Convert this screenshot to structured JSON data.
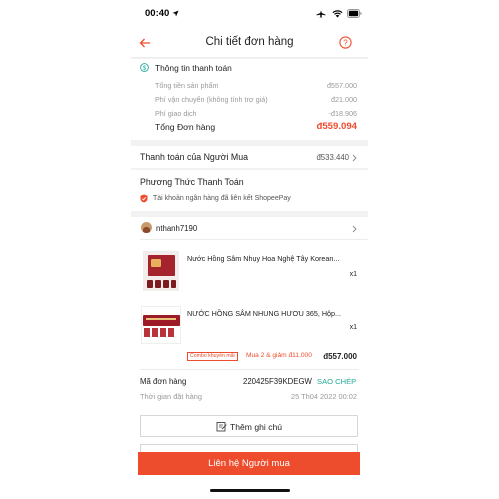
{
  "status_bar": {
    "time": "00:40"
  },
  "header": {
    "title": "Chi tiết đơn hàng"
  },
  "payment_info": {
    "title": "Thông tin thanh toán",
    "rows": [
      {
        "label": "Tổng tiền sản phẩm",
        "value": "đ557.000"
      },
      {
        "label": "Phí vận chuyển (không tính trợ giá)",
        "value": "đ21.000"
      },
      {
        "label": "Phí giao dịch",
        "value": "-đ18.906"
      }
    ],
    "total_label": "Tổng Đơn hàng",
    "total_value": "đ559.094"
  },
  "buyer_payment": {
    "label": "Thanh toán của Người Mua",
    "value": "đ533.440"
  },
  "payment_method": {
    "title": "Phương Thức Thanh Toán",
    "desc": "Tài khoản ngân hàng đã liên kết ShopeePay"
  },
  "shop": {
    "name": "nthanh7190"
  },
  "products": [
    {
      "name": "Nước Hồng Sâm Nhụy Hoa Nghệ Tây Korean...",
      "qty": "x1"
    },
    {
      "name": "NƯỚC HỒNG SÂM NHUNG HƯƠU 365, Hộp...",
      "qty": "x1"
    }
  ],
  "combo": {
    "badge": "Combo khuyến mãi",
    "text": "Mua 2 & giảm đ11.000",
    "total": "đ557.000"
  },
  "order": {
    "id_label": "Mã đơn hàng",
    "id_value": "220425F39KDEGW",
    "copy_label": "SAO CHÉP",
    "time_label": "Thời gian đặt hàng",
    "time_value": "25 Th04 2022 00:02"
  },
  "actions": {
    "note_label": "Thêm ghi chú",
    "contact_label": "Liên hệ Người mua"
  },
  "colors": {
    "accent": "#ee4d2d",
    "green": "#26aa99"
  }
}
